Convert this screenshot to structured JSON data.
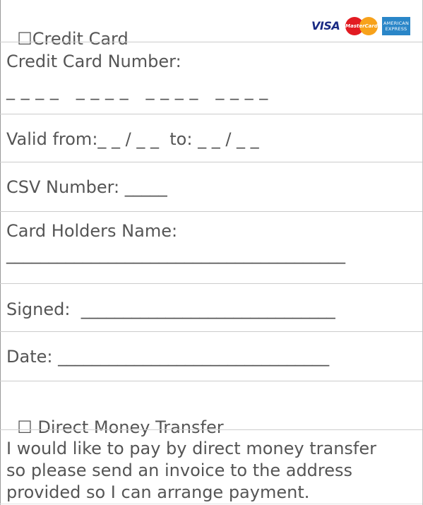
{
  "credit_card_option": {
    "checkbox_glyph": "☐",
    "label": "Credit Card",
    "checked": false
  },
  "card_logos": {
    "visa": "VISA",
    "mastercard": "MasterCard",
    "amex_line1": "AMERICAN",
    "amex_line2": "EXPRESS",
    "colors": {
      "visa": "#1a2b84",
      "mastercard_red": "#e21b22",
      "mastercard_orange": "#f7a21b",
      "amex": "#2a86c8"
    }
  },
  "card_number": {
    "label": "Credit Card Number:",
    "blank": "_ _ _ _   _ _ _ _   _ _ _ _   _ _ _ _"
  },
  "validity": {
    "text": "Valid from:_ _ / _ _  to: _ _ / _ _"
  },
  "csv": {
    "text": "CSV Number: _____"
  },
  "holder": {
    "label": "Card Holders Name:",
    "blank": "________________________________________"
  },
  "signed": {
    "text": "Signed:  ______________________________"
  },
  "date": {
    "text": "Date: ________________________________"
  },
  "transfer_option": {
    "checkbox_glyph": "☐",
    "label": " Direct Money Transfer",
    "checked": false
  },
  "transfer_note": {
    "line1": "I would like to pay by direct money transfer",
    "line2": "so please send an invoice to the address",
    "line3": "provided so I can arrange payment."
  }
}
